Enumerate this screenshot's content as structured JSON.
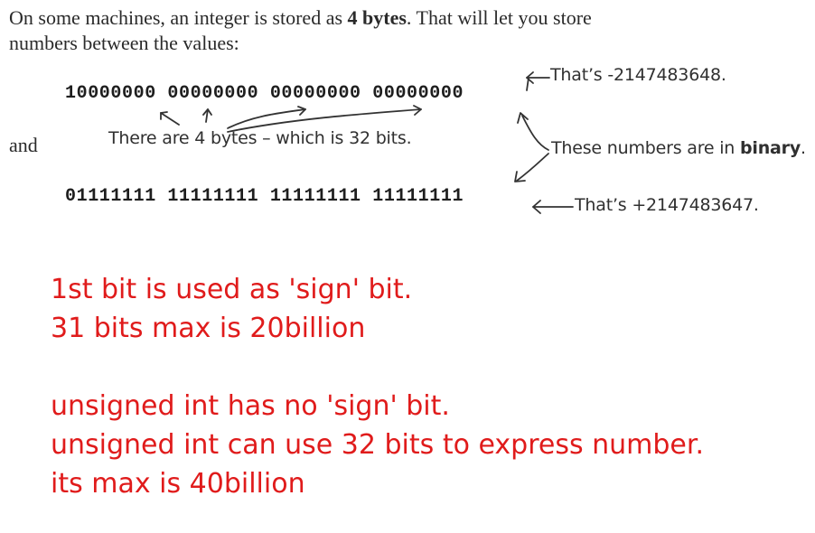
{
  "intro": {
    "text_before": "On some machines, an integer is stored as ",
    "bold": "4 bytes",
    "text_after": ". That will let you store",
    "line2": "numbers between the values:"
  },
  "binary": {
    "min": "10000000 00000000 00000000 00000000",
    "max": "01111111 11111111 11111111 11111111"
  },
  "conjunction": "and",
  "annotations": {
    "min_value": "That’s -2147483648.",
    "max_value": "That’s +2147483647.",
    "bytes_note": "There are 4 bytes – which is 32 bits.",
    "binary_note_prefix": "These numbers are in ",
    "binary_note_word": "binary",
    "binary_note_suffix": "."
  },
  "notes": [
    "1st bit is used as 'sign' bit.",
    "31 bits max is 20billion",
    "",
    "unsigned int has no 'sign' bit.",
    "unsigned int can use 32 bits to express number.",
    "its max is 40billion"
  ],
  "colors": {
    "note_red": "#e01b1b",
    "ink": "#303030"
  }
}
